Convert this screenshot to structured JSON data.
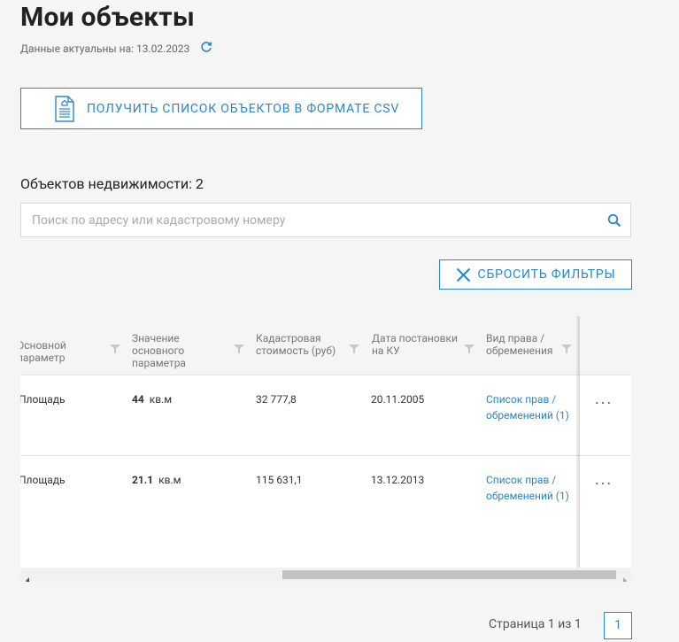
{
  "page": {
    "title": "Мои объекты",
    "updated_text": "Данные актуальны на: 13.02.2023"
  },
  "toolbar": {
    "csv_button_label": "ПОЛУЧИТЬ СПИСОК ОБЪЕКТОВ В ФОРМАТЕ CSV",
    "reset_filters_label": "СБРОСИТЬ ФИЛЬТРЫ"
  },
  "objects_count_text": "Объектов недвижимости: 2",
  "search": {
    "placeholder": "Поиск по адресу или кадастровому номеру",
    "value": ""
  },
  "table": {
    "columns": [
      "Основной параметр",
      "Значение основного параметра",
      "Кадастровая стоимость (руб)",
      "Дата постановки на КУ",
      "Вид права / обременения"
    ],
    "rows": [
      {
        "param": "Площадь",
        "value_num": "44",
        "value_unit": "кв.м",
        "cost": "32 777,8",
        "date": "20.11.2005",
        "rights_link": "Список прав / обременений (1)",
        "menu": "..."
      },
      {
        "param": "Площадь",
        "value_num": "21.1",
        "value_unit": "кв.м",
        "cost": "115 631,1",
        "date": "13.12.2013",
        "rights_link": "Список прав / обременений (1)",
        "menu": "..."
      }
    ]
  },
  "pagination": {
    "text": "Страница 1 из 1",
    "current": "1"
  },
  "colors": {
    "accent": "#2b86c6",
    "background": "#f5f5f5"
  },
  "icons": {
    "refresh": "refresh-icon",
    "document": "document-icon",
    "search": "search-icon",
    "close": "close-icon",
    "filter": "filter-icon",
    "more": "more-dots-icon"
  }
}
